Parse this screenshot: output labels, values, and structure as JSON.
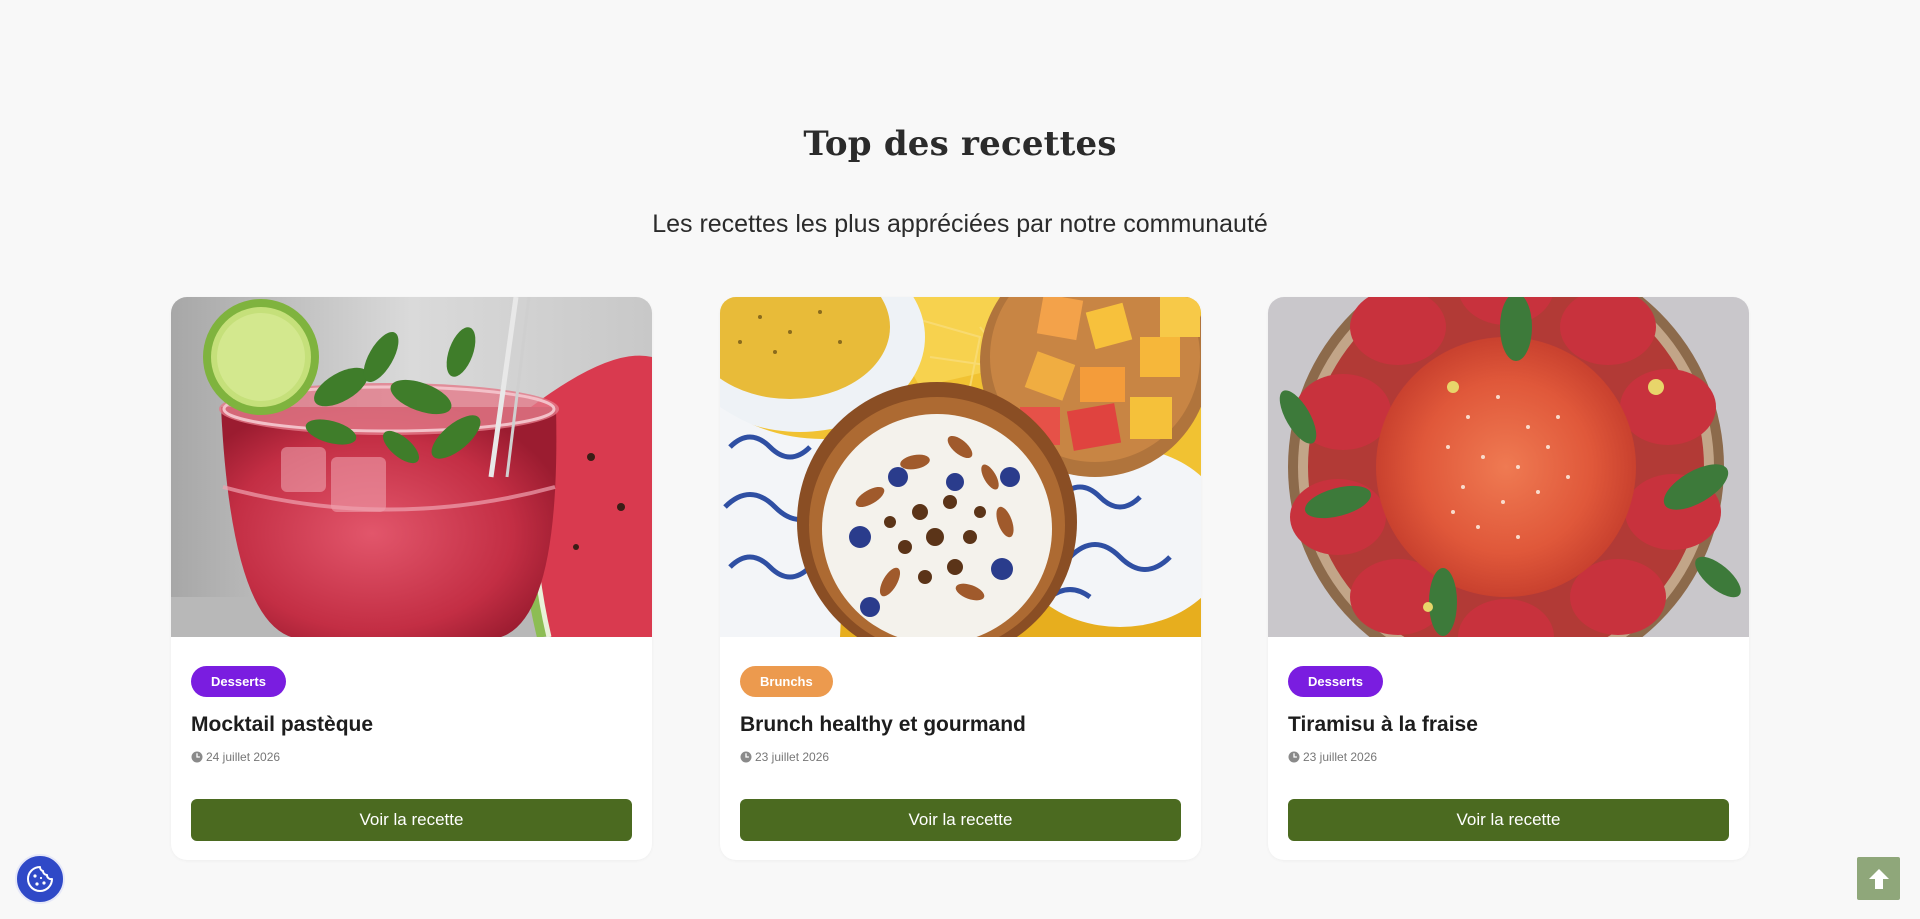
{
  "section": {
    "title": "Top des recettes",
    "subtitle": "Les recettes les plus appréciées par notre communauté"
  },
  "recipes": [
    {
      "category": "Desserts",
      "category_color": "#7a1de0",
      "title": "Mocktail pastèque",
      "date": "24 juillet 2026",
      "button_label": "Voir la recette",
      "image_alt": "watermelon mocktail with mint and lime"
    },
    {
      "category": "Brunchs",
      "category_color": "#ec9a4e",
      "title": "Brunch healthy et gourmand",
      "date": "23 juillet 2026",
      "button_label": "Voir la recette",
      "image_alt": "yogurt bowl with granola, almonds, blueberries and fruit"
    },
    {
      "category": "Desserts",
      "category_color": "#7a1de0",
      "title": "Tiramisu à la fraise",
      "date": "23 juillet 2026",
      "button_label": "Voir la recette",
      "image_alt": "strawberry tiramisu with coconut and mint"
    }
  ],
  "colors": {
    "page_background": "#f8f8f8",
    "card_background": "#ffffff",
    "button_green": "#4b6a20",
    "cookie_blue": "#2f49c7",
    "scroll_top_green": "#8fa77a"
  },
  "icons": {
    "date": "clock-icon",
    "cookie": "cookie-icon",
    "scroll_top": "arrow-up-icon"
  }
}
